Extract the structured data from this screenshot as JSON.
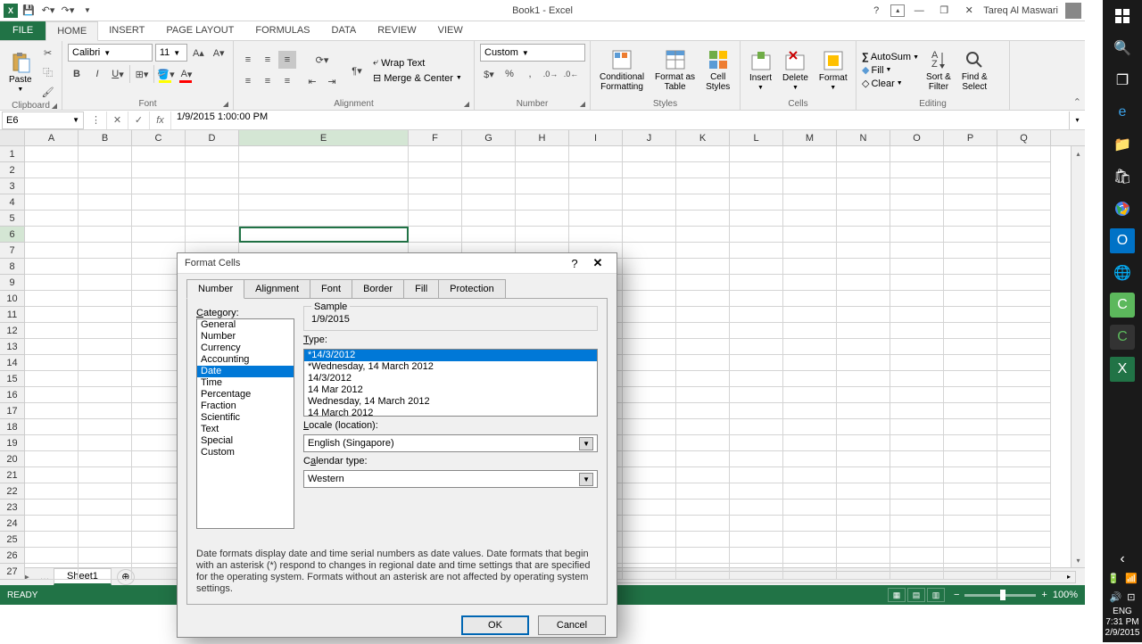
{
  "app": {
    "title": "Book1 - Excel"
  },
  "user": {
    "name": "Tareq Al Maswari"
  },
  "ribbon_tabs": {
    "file": "FILE",
    "home": "HOME",
    "insert": "INSERT",
    "page_layout": "PAGE LAYOUT",
    "formulas": "FORMULAS",
    "data": "DATA",
    "review": "REVIEW",
    "view": "VIEW"
  },
  "ribbon": {
    "clipboard": {
      "label": "Clipboard",
      "paste": "Paste"
    },
    "font": {
      "label": "Font",
      "name": "Calibri",
      "size": "11"
    },
    "alignment": {
      "label": "Alignment",
      "wrap": "Wrap Text",
      "merge": "Merge & Center"
    },
    "number": {
      "label": "Number",
      "format": "Custom"
    },
    "styles": {
      "label": "Styles",
      "conditional": "Conditional\nFormatting",
      "table": "Format as\nTable",
      "cell": "Cell\nStyles"
    },
    "cells": {
      "label": "Cells",
      "insert": "Insert",
      "delete": "Delete",
      "format": "Format"
    },
    "editing": {
      "label": "Editing",
      "autosum": "AutoSum",
      "fill": "Fill",
      "clear": "Clear",
      "sort": "Sort &\nFilter",
      "find": "Find &\nSelect"
    }
  },
  "formula_bar": {
    "cell_ref": "E6",
    "formula": "1/9/2015  1:00:00 PM"
  },
  "columns": [
    "A",
    "B",
    "C",
    "D",
    "E",
    "F",
    "G",
    "H",
    "I",
    "J",
    "K",
    "L",
    "M",
    "N",
    "O",
    "P",
    "Q"
  ],
  "selected_col": "E",
  "selected_row": 6,
  "row_count": 27,
  "sheet": {
    "name": "Sheet1"
  },
  "status": {
    "text": "READY",
    "zoom": "100%"
  },
  "dialog": {
    "title": "Format Cells",
    "tabs": [
      "Number",
      "Alignment",
      "Font",
      "Border",
      "Fill",
      "Protection"
    ],
    "active_tab": "Number",
    "category_label": "Category:",
    "categories": [
      "General",
      "Number",
      "Currency",
      "Accounting",
      "Date",
      "Time",
      "Percentage",
      "Fraction",
      "Scientific",
      "Text",
      "Special",
      "Custom"
    ],
    "selected_category": "Date",
    "sample_label": "Sample",
    "sample_value": "1/9/2015",
    "type_label": "Type:",
    "types": [
      "*14/3/2012",
      "*Wednesday, 14 March 2012",
      "14/3/2012",
      "14 Mar 2012",
      "Wednesday, 14 March 2012",
      "14 March 2012"
    ],
    "selected_type": "*14/3/2012",
    "locale_label": "Locale (location):",
    "locale_value": "English (Singapore)",
    "calendar_label": "Calendar type:",
    "calendar_value": "Western",
    "help_text": "Date formats display date and time serial numbers as date values.  Date formats that begin with an asterisk (*) respond to changes in regional date and time settings that are specified for the operating system. Formats without an asterisk are not affected by operating system settings.",
    "ok": "OK",
    "cancel": "Cancel"
  },
  "taskbar": {
    "lang": "ENG",
    "time": "7:31 PM",
    "date": "2/9/2015"
  }
}
